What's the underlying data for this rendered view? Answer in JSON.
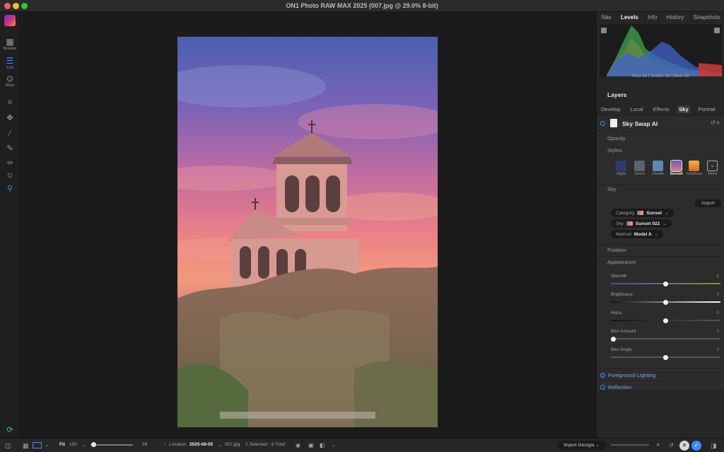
{
  "window": {
    "title": "ON1 Photo RAW MAX 2025 (007.jpg @ 29.0% 8-bit)"
  },
  "left_tools": {
    "browse_label": "Browse",
    "edit_label": "Edit",
    "more_label": "More"
  },
  "right_panel": {
    "tabs": [
      "Nav",
      "Levels",
      "Info",
      "History",
      "Snapshots"
    ],
    "active_tab": "Levels",
    "histogram_readout": {
      "red_label": "Red",
      "red": "36",
      "green_label": "| Green",
      "green": "36",
      "blue_label": "| Blue",
      "blue": "36"
    },
    "layers_title": "Layers",
    "module_tabs": [
      "Develop",
      "Local",
      "Effects",
      "Sky",
      "Portrait"
    ],
    "active_module": "Sky",
    "filter": {
      "name": "Sky Swap AI",
      "sections": {
        "opacity": "Opacity",
        "styles": "Styles",
        "sky": "Sky",
        "position": "Position",
        "appearance": "Appearance",
        "foreground_lighting": "Foreground Lighting",
        "reflection": "Reflection"
      },
      "styles": [
        {
          "label": "Night",
          "color": "#2b3b6e"
        },
        {
          "label": "Storm",
          "color": "#5a6470"
        },
        {
          "label": "Clouds",
          "color": "#5f86b3"
        },
        {
          "label": "Sunset",
          "color": "#b86aa6"
        },
        {
          "label": "Goldhour",
          "color": "#e0913c"
        },
        {
          "label": "More",
          "color": "#3a3a3a"
        }
      ],
      "selected_style": "Sunset",
      "import_label": "Import",
      "category": {
        "label": "Category",
        "value": "Sunset"
      },
      "sky": {
        "label": "Sky",
        "value": "Sunset 022"
      },
      "method": {
        "label": "Method",
        "value": "Model A"
      },
      "sliders": [
        {
          "label": "Warmth",
          "value": "0",
          "position": 0.5
        },
        {
          "label": "Brightness",
          "value": "0",
          "position": 0.5
        },
        {
          "label": "Haze",
          "value": "0",
          "position": 0.5
        },
        {
          "label": "Blur Amount",
          "value": "0",
          "position": 0.0
        },
        {
          "label": "Blur Angle",
          "value": "0",
          "position": 0.5
        }
      ]
    }
  },
  "bottom_bar": {
    "fit_label": "Fit",
    "zoom_value": "100",
    "thumb_size": "29",
    "location_label": "Location",
    "location_value": "2025-08-05",
    "file_name": "007.jpg",
    "selection_status": "1 Selected - 9 Total",
    "import_button": "Import Georgia",
    "cancel_icon": "✕",
    "done_icon": "✓"
  },
  "colors": {
    "accent": "#3d8bfd",
    "panel": "#2c2c2c"
  }
}
